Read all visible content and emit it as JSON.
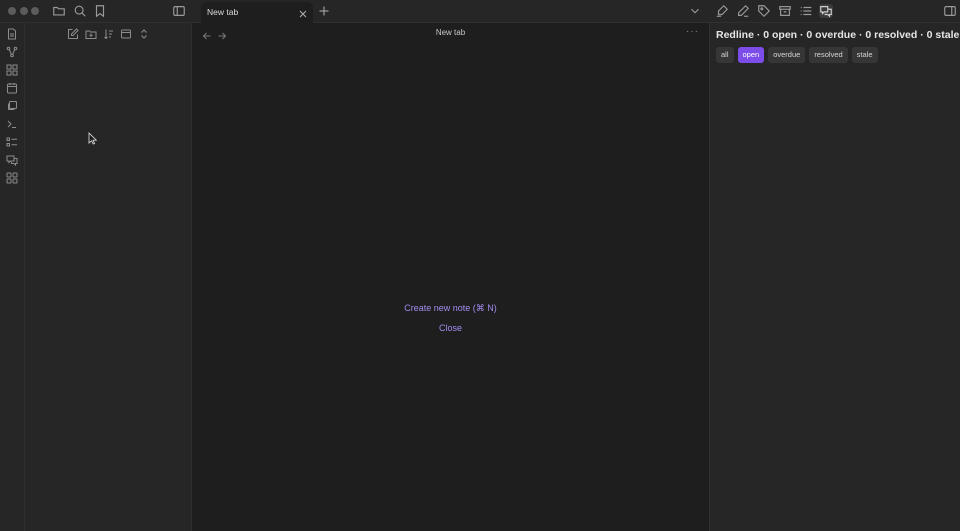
{
  "tab": {
    "title": "New tab"
  },
  "main": {
    "title": "New tab",
    "create_note": "Create new note (⌘ N)",
    "close": "Close"
  },
  "redline": {
    "title": "Redline",
    "open_count": 0,
    "overdue_count": 0,
    "resolved_count": 0,
    "stale_count": 0,
    "summary": "Redline · 0 open · 0 overdue · 0 resolved · 0 stale",
    "filters": [
      "all",
      "open",
      "overdue",
      "resolved",
      "stale"
    ],
    "active_filter": "open"
  },
  "colors": {
    "accent": "#7c4de8",
    "link": "#a48cf0",
    "background": "#1e1e1e",
    "panel": "#262626"
  },
  "icons": {
    "topbar_left": [
      "folder-icon",
      "search-icon",
      "bookmark-icon",
      "sidebar-toggle-icon"
    ],
    "topbar_right": [
      "highlighter-icon",
      "pen-icon",
      "tag-icon",
      "archive-icon",
      "list-icon",
      "comments-icon",
      "right-sidebar-toggle-icon"
    ],
    "ribbon": [
      "file-icon",
      "graph-icon",
      "canvas-icon",
      "calendar-icon",
      "copy-icon",
      "terminal-icon",
      "checklist-icon",
      "chat-icon",
      "apps-icon"
    ],
    "explorer": [
      "new-note-icon",
      "new-folder-icon",
      "sort-icon",
      "collapse-icon",
      "expand-icon"
    ]
  }
}
